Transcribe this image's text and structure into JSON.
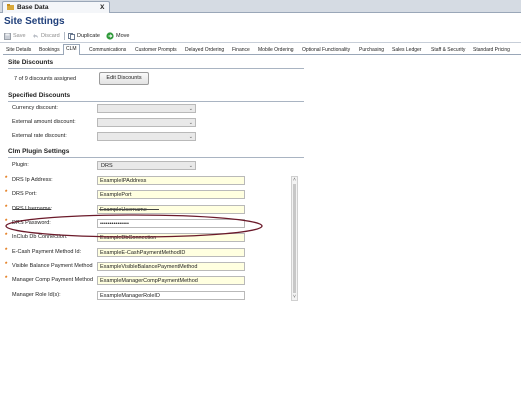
{
  "window": {
    "doc_tab_label": "Base Data",
    "doc_tab_close": "x",
    "page_title": "Site Settings"
  },
  "toolbar": {
    "save": "Save",
    "discard": "Discard",
    "duplicate": "Duplicate",
    "move": "Move"
  },
  "tabs": [
    "Site Details",
    "Bookings",
    "CLM",
    "Communications",
    "Customer Prompts",
    "Delayed Ordering",
    "Finance",
    "Mobile Ordering",
    "Optional Functionality",
    "Purchasing",
    "Sales Ledger",
    "Staff & Security",
    "Standard Pricing"
  ],
  "active_tab": "CLM",
  "site_discounts": {
    "header": "Site Discounts",
    "assigned_text": "7 of 9 discounts assigned",
    "edit_button": "Edit Discounts"
  },
  "specified_discounts": {
    "header": "Specified Discounts",
    "currency_label": "Currency discount:",
    "external_amount_label": "External amount discount:",
    "external_rate_label": "External rate discount:",
    "currency_value": "",
    "external_amount_value": "",
    "external_rate_value": ""
  },
  "plugin": {
    "header": "Clm Plugin Settings",
    "plugin_label": "Plugin:",
    "plugin_value": "DRS",
    "fields": [
      {
        "label": "DRS Ip Address:",
        "value": "ExampleIPAddress"
      },
      {
        "label": "DRS Port:",
        "value": "ExamplePort"
      },
      {
        "label": "DRS Username:",
        "value": "ExampleUsername"
      },
      {
        "label": "DRS Password:",
        "value": "•••••••••••••••"
      },
      {
        "label": "InClub Db Connection:",
        "value": "ExampleDbConnection"
      },
      {
        "label": "E-Cash Payment Method Id:",
        "value": "ExampleE-CashPaymentMethodID"
      },
      {
        "label": "Visible Balance Payment Method",
        "value": "ExampleVisibleBalancePaymentMethod"
      },
      {
        "label": "Manager Comp Payment Method",
        "value": "ExampleManagerCompPaymentMethod"
      },
      {
        "label": "Manager Role Id(s):",
        "value": "ExampleManagerRoleID"
      }
    ]
  },
  "colors": {
    "title": "#1f3f7a",
    "required_marker": "#e06b00",
    "field_bg": "#ffffe0",
    "annotation": "#6b1a2a"
  }
}
